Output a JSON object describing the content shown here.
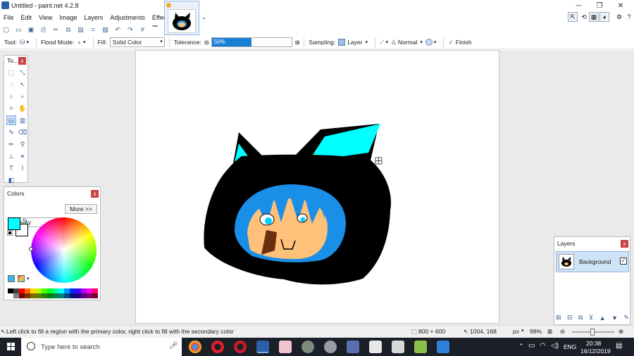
{
  "window": {
    "title": "Untitled - paint.net 4.2.8"
  },
  "menu": [
    "File",
    "Edit",
    "View",
    "Image",
    "Layers",
    "Adjustments",
    "Effects"
  ],
  "options": {
    "tool_label": "Tool:",
    "flood_mode_label": "Flood Mode:",
    "fill_label": "Fill:",
    "fill_value": "Solid Color",
    "tolerance_label": "Tolerance:",
    "tolerance_value": "50%",
    "tolerance_fraction": 0.5,
    "sampling_label": "Sampling:",
    "sampling_value": "Layer",
    "blend_value": "Normal",
    "finish_label": "Finish"
  },
  "tools_panel": {
    "title": "To..."
  },
  "colors_panel": {
    "title": "Colors",
    "mode": "Primary",
    "more_button": "More >>",
    "primary_color": "#00ffff",
    "secondary_color": "#ffffff"
  },
  "layers_panel": {
    "title": "Layers",
    "layer_name": "Background"
  },
  "status": {
    "hint": "Left click to fill a region with the primary color, right click to fill with the secondary color",
    "image_size": "800 × 600",
    "cursor_pos": "1004, 168",
    "unit": "px",
    "zoom": "98%"
  },
  "taskbar": {
    "search_placeholder": "Type here to search",
    "language": "ENG",
    "time": "20:38",
    "date": "16/12/2019"
  },
  "colors": {
    "accent": "#1a7fd6",
    "drawing_black": "#000000",
    "drawing_cyan": "#00ffff",
    "drawing_blue": "#1a8fe8",
    "drawing_skin": "#ffc07a",
    "drawing_brown": "#6b2e0e"
  }
}
